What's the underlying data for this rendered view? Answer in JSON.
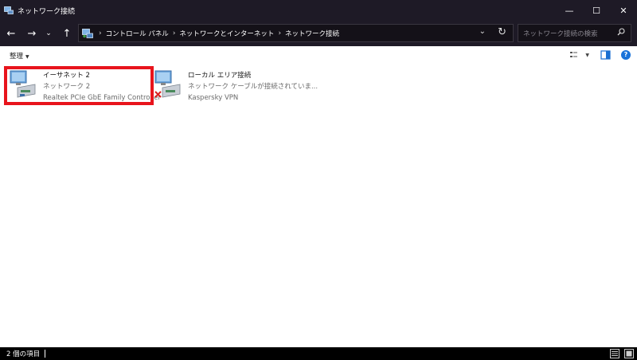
{
  "window": {
    "title": "ネットワーク接続",
    "minimize_glyph": "—",
    "maximize_glyph": "☐",
    "close_glyph": "✕"
  },
  "nav": {
    "back_glyph": "←",
    "forward_glyph": "→",
    "recent_glyph": "⌄",
    "up_glyph": "↑",
    "breadcrumbs": [
      "コントロール パネル",
      "ネットワークとインターネット",
      "ネットワーク接続"
    ],
    "separator": "›",
    "dropdown_glyph": "⌄",
    "refresh_glyph": "↻"
  },
  "search": {
    "placeholder": "ネットワーク接続の検索",
    "icon": "search-icon"
  },
  "toolbar": {
    "organize_label": "整理",
    "organize_caret": "▼",
    "help_label": "?"
  },
  "connections": [
    {
      "name": "イーサネット 2",
      "status": "ネットワーク 2",
      "adapter": "Realtek PCIe GbE Family Controller",
      "icon": "network-adapter-icon",
      "disconnected": false,
      "highlighted": true
    },
    {
      "name": "ローカル エリア接続",
      "status": "ネットワーク ケーブルが接続されていま...",
      "adapter": "Kaspersky VPN",
      "icon": "network-adapter-disconnected-icon",
      "disconnected": true,
      "highlighted": false
    }
  ],
  "status_bar": {
    "item_count": "2 個の項目"
  },
  "colors": {
    "highlight": "#e8141c",
    "titlebar": "#1e1a26",
    "help": "#1a73d9"
  }
}
